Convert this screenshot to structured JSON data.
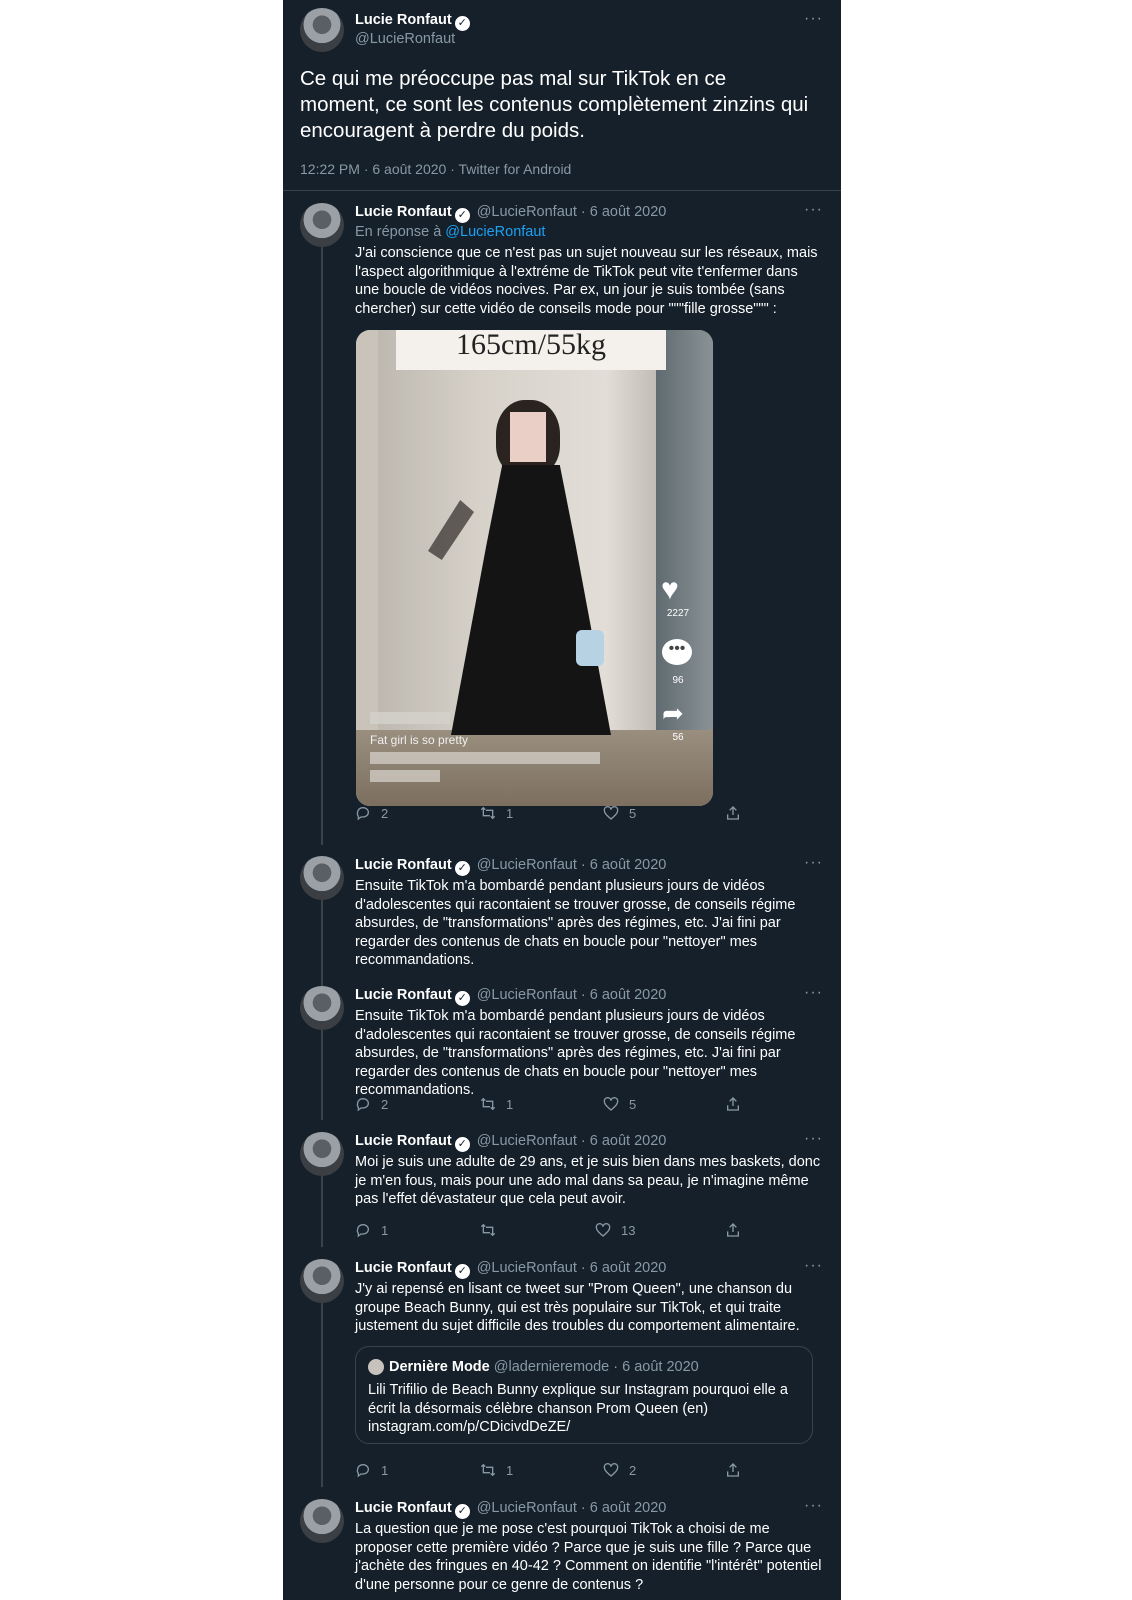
{
  "user": {
    "name": "Lucie Ronfaut",
    "handle": "@LucieRonfaut",
    "verified_glyph": "✓"
  },
  "more_glyph": "···",
  "main_tweet": {
    "text": "Ce qui me préoccupe pas mal sur TikTok en ce moment, ce sont les contenus complètement zinzins qui encouragent à perdre du poids.",
    "meta": "12:22 PM · 6 août 2020 · Twitter for Android"
  },
  "replies": [
    {
      "date": "· 6 août 2020",
      "reply_to_label": "En réponse à",
      "reply_to_handle": "@LucieRonfaut",
      "text": "J'ai conscience que ce n'est pas un sujet nouveau sur les réseaux, mais l'aspect algorithmique à l'extréme de TikTok peut vite t'enfermer dans une boucle de vidéos nocives. Par ex, un jour je suis tombée (sans chercher) sur cette vidéo de conseils mode pour \"\"\"fille grosse\"\"\" :",
      "media": {
        "caption_top": "165cm/55kg",
        "caption_bottom": "Fat girl is so pretty",
        "likes": "2227",
        "comments": "96",
        "shares": "56"
      },
      "stats": {
        "replies": "2",
        "retweets": "1",
        "likes": "5"
      }
    },
    {
      "date": "· 6 août 2020",
      "text": "Ensuite TikTok m'a bombardé pendant plusieurs jours de vidéos d'adolescentes qui racontaient se trouver grosse, de conseils régime absurdes, de \"transformations\" après des régimes, etc. J'ai fini par regarder des contenus de chats en boucle pour \"nettoyer\" mes recommandations."
    },
    {
      "date": "· 6 août 2020",
      "text": "Ensuite TikTok m'a bombardé pendant plusieurs jours de vidéos d'adolescentes qui racontaient se trouver grosse, de conseils régime absurdes, de \"transformations\" après des régimes, etc. J'ai fini par regarder des contenus de chats en boucle pour \"nettoyer\" mes recommandations.",
      "stats": {
        "replies": "2",
        "retweets": "1",
        "likes": "5"
      }
    },
    {
      "date": "· 6 août 2020",
      "text": "Moi je suis une adulte de 29 ans, et je suis bien dans mes baskets, donc je m'en fous, mais pour une ado mal dans sa peau, je n'imagine même pas l'effet dévastateur que cela peut avoir.",
      "stats": {
        "replies": "1",
        "retweets": "",
        "likes": "13"
      }
    },
    {
      "date": "· 6 août 2020",
      "text": "J'y ai repensé en lisant ce tweet sur \"Prom Queen\", une chanson du groupe Beach Bunny, qui est très populaire sur TikTok, et qui traite justement du sujet difficile des troubles du comportement alimentaire.",
      "quote": {
        "name": "Dernière Mode",
        "handle": "@ladernieremode",
        "date": "· 6 août 2020",
        "text": "Lili Trifilio de Beach Bunny explique sur Instagram pourquoi elle a écrit la désormais célèbre chanson Prom Queen (en) instagram.com/p/CDicivdDeZE/"
      },
      "stats": {
        "replies": "1",
        "retweets": "1",
        "likes": "2"
      }
    },
    {
      "date": "· 6 août 2020",
      "text": "La question que je me pose c'est pourquoi TikTok a choisi de me proposer cette première vidéo ? Parce que je suis une fille ? Parce que j'achète des fringues en 40-42 ? Comment on identifie \"l'intérêt\" potentiel d'une personne pour ce genre de contenus ?"
    }
  ]
}
